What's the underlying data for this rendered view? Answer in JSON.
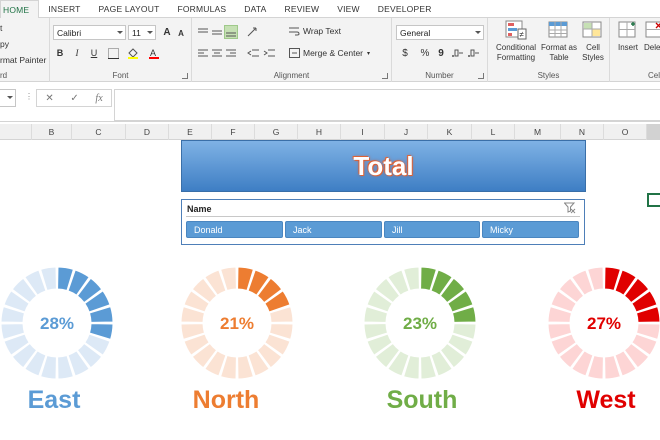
{
  "ribbon": {
    "tabs": [
      "HOME",
      "INSERT",
      "PAGE LAYOUT",
      "FORMULAS",
      "DATA",
      "REVIEW",
      "VIEW",
      "DEVELOPER"
    ],
    "clipboard": {
      "cut": "t",
      "copy": "py",
      "format_painter": "rmat Painter",
      "label": "rd"
    },
    "font": {
      "name": "Calibri",
      "size": "11",
      "bold": "B",
      "italic": "I",
      "underline": "U",
      "grow": "A",
      "shrink": "A",
      "label": "Font"
    },
    "alignment": {
      "wrap_text": "Wrap Text",
      "merge_center": "Merge & Center",
      "label": "Alignment"
    },
    "number": {
      "format": "General",
      "currency": "$",
      "percent": "%",
      "comma": "9",
      "label": "Number"
    },
    "styles": {
      "conditional": [
        "Conditional",
        "Formatting"
      ],
      "format_table": [
        "Format as",
        "Table"
      ],
      "cell_styles": [
        "Cell",
        "Styles"
      ],
      "label": "Styles"
    },
    "cells": {
      "insert": "Insert",
      "delete": "Delete",
      "label": "Cell"
    }
  },
  "formula_bar": {
    "fx": "fx",
    "cancel": "✕",
    "enter": "✓",
    "value": ""
  },
  "columns": [
    "B",
    "C",
    "D",
    "E",
    "F",
    "G",
    "H",
    "I",
    "J",
    "K",
    "L",
    "M",
    "N",
    "O"
  ],
  "dashboard": {
    "title": "Total",
    "slicer": {
      "header": "Name",
      "items": [
        "Donald",
        "Jack",
        "Jill",
        "Micky"
      ]
    },
    "regions": [
      {
        "name": "East",
        "percent": 0.28,
        "label": "28%",
        "color": "#5b9bd5",
        "light": "#dde9f6"
      },
      {
        "name": "North",
        "percent": 0.21,
        "label": "21%",
        "color": "#ed7d31",
        "light": "#fbe3d4"
      },
      {
        "name": "South",
        "percent": 0.23,
        "label": "23%",
        "color": "#70ad47",
        "light": "#e1eed8"
      },
      {
        "name": "West",
        "percent": 0.27,
        "label": "27%",
        "color": "#e00000",
        "light": "#fdd5d5"
      }
    ]
  }
}
